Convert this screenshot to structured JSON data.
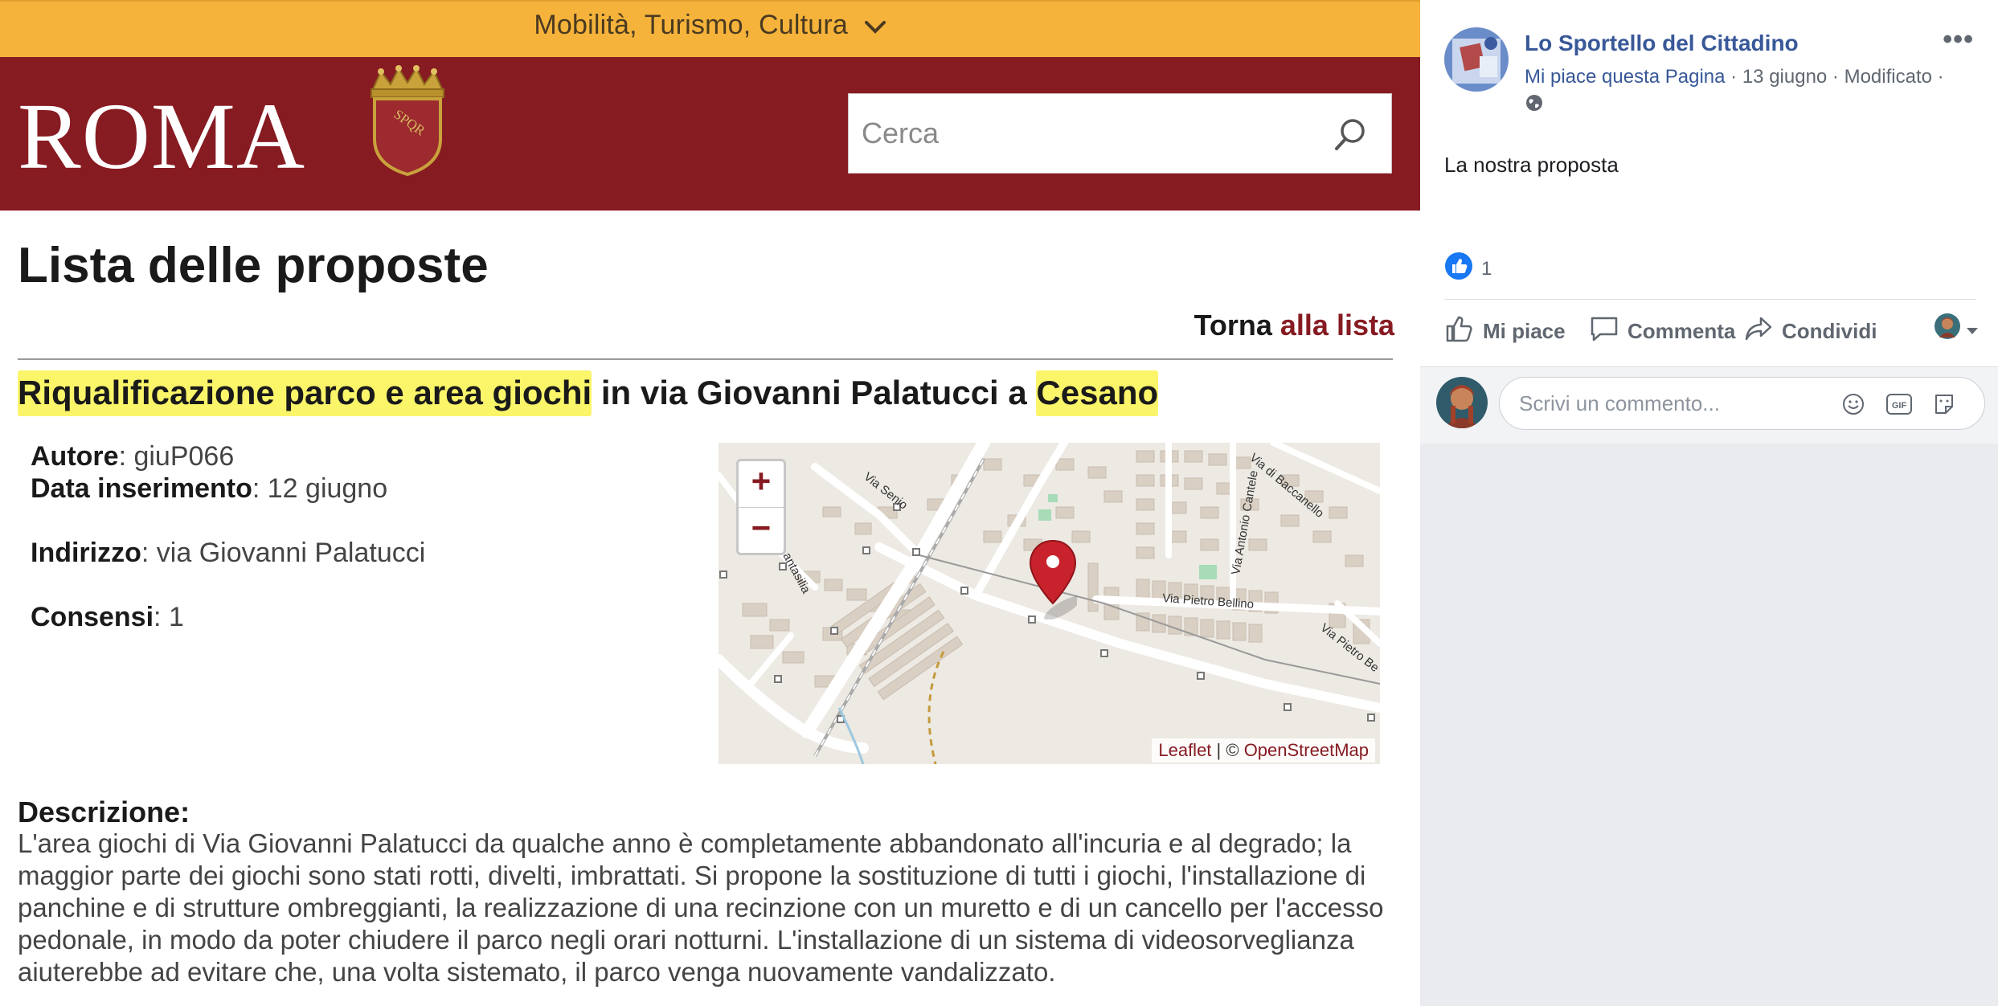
{
  "roma": {
    "topbar_label": "Mobilità, Turismo, Cultura",
    "logo_text": "ROMA",
    "crest_text": "SPQR",
    "search_placeholder": "Cerca",
    "page_title": "Lista delle proposte",
    "back_prefix": "Torna ",
    "back_link": "alla lista",
    "proposal_title": {
      "hl1": "Riqualificazione parco e area giochi",
      "mid": " in via Giovanni Palatucci a ",
      "hl2": "Cesano"
    },
    "meta": {
      "autore_label": "Autore",
      "autore_value": "giuP066",
      "data_label": "Data inserimento",
      "data_value": "12 giugno",
      "indirizzo_label": "Indirizzo",
      "indirizzo_value": "via Giovanni Palatucci",
      "consensi_label": "Consensi",
      "consensi_value": "1"
    },
    "map": {
      "zoom_in": "+",
      "zoom_out": "−",
      "attribution_leaflet": "Leaflet",
      "attribution_sep": " | © ",
      "attribution_osm": "OpenStreetMap",
      "street_labels": [
        "Via Senio",
        "Via di Baccanello",
        "Via Antonio Cantele",
        "Via Pietro Bellino",
        "Via Pietro Be",
        "antasilia"
      ]
    },
    "description_label": "Descrizione:",
    "description_text": "L'area giochi di Via Giovanni Palatucci da qualche anno è completamente abbandonato all'incuria e al degrado; la maggior parte dei giochi sono stati rotti, divelti, imbrattati. Si propone la sostituzione di tutti i giochi, l'installazione di panchine e di strutture ombreggianti, la realizzazione di una recinzione con un muretto e di un cancello per l'accesso pedonale, in modo da poter chiudere il parco negli orari notturni. L'installazione di un sistema di videosorveglianza aiuterebbe ad evitare che, una volta sistemato, il parco venga nuovamente vandalizzato."
  },
  "facebook": {
    "page_name": "Lo Sportello del Cittadino",
    "more": "•••",
    "like_page": "Mi piace questa Pagina",
    "meta_rest": " · 13 giugno · Modificato ·",
    "post_text": "La nostra proposta",
    "reaction_count": "1",
    "actions": {
      "like": "Mi piace",
      "comment": "Commenta",
      "share": "Condividi"
    },
    "comment_placeholder": "Scrivi un commento...",
    "gif_label": "GIF"
  },
  "colors": {
    "roma_red": "#871b22",
    "topbar_orange": "#f6b33b",
    "highlight_yellow": "#fbf56a",
    "fb_blue": "#385898",
    "map_bg": "#ede9e3",
    "marker_red": "#c8232c"
  }
}
